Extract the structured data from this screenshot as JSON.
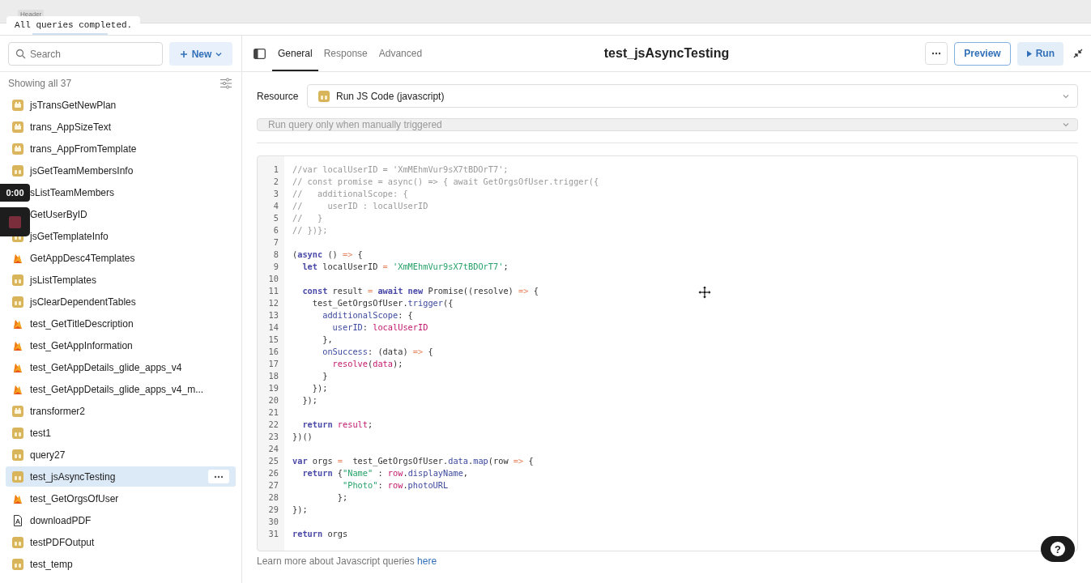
{
  "canvas_header": {
    "tag": "Header",
    "toast": "All queries completed."
  },
  "recorder": {
    "time": "0:00"
  },
  "sidebar": {
    "search": {
      "placeholder": "Search"
    },
    "new_button": "New",
    "count": "Showing all 37",
    "items": [
      {
        "label": "jsTransGetNewPlan",
        "kind": "transformer",
        "selected": false
      },
      {
        "label": "trans_AppSizeText",
        "kind": "transformer",
        "selected": false
      },
      {
        "label": "trans_AppFromTemplate",
        "kind": "transformer",
        "selected": false
      },
      {
        "label": "jsGetTeamMembersInfo",
        "kind": "js",
        "selected": false
      },
      {
        "label": "sListTeamMembers",
        "kind": "covered",
        "selected": false
      },
      {
        "label": "GetUserByID",
        "kind": "covered",
        "selected": false
      },
      {
        "label": "jsGetTemplateInfo",
        "kind": "js",
        "selected": false
      },
      {
        "label": "GetAppDesc4Templates",
        "kind": "firebase",
        "selected": false
      },
      {
        "label": "jsListTemplates",
        "kind": "js",
        "selected": false
      },
      {
        "label": "jsClearDependentTables",
        "kind": "js",
        "selected": false
      },
      {
        "label": "test_GetTitleDescription",
        "kind": "firebase",
        "selected": false
      },
      {
        "label": "test_GetAppInformation",
        "kind": "firebase",
        "selected": false
      },
      {
        "label": "test_GetAppDetails_glide_apps_v4",
        "kind": "firebase",
        "selected": false
      },
      {
        "label": "test_GetAppDetails_glide_apps_v4_m...",
        "kind": "firebase",
        "selected": false
      },
      {
        "label": "transformer2",
        "kind": "transformer",
        "selected": false
      },
      {
        "label": "test1",
        "kind": "js",
        "selected": false
      },
      {
        "label": "query27",
        "kind": "js",
        "selected": false
      },
      {
        "label": "test_jsAsyncTesting",
        "kind": "js",
        "selected": true
      },
      {
        "label": "test_GetOrgsOfUser",
        "kind": "firebase",
        "selected": false
      },
      {
        "label": "downloadPDF",
        "kind": "pdf",
        "selected": false
      },
      {
        "label": "testPDFOutput",
        "kind": "js",
        "selected": false
      },
      {
        "label": "test_temp",
        "kind": "js",
        "selected": false
      }
    ]
  },
  "editor": {
    "tabs": [
      {
        "label": "General",
        "selected": true
      },
      {
        "label": "Response",
        "selected": false
      },
      {
        "label": "Advanced",
        "selected": false
      }
    ],
    "title": "test_jsAsyncTesting",
    "preview_button": "Preview",
    "run_button": "Run",
    "resource_label": "Resource",
    "resource_value": "Run JS Code (javascript)",
    "trigger_value": "Run query only when manually triggered",
    "code": [
      {
        "num": "1",
        "tokens": [
          {
            "kind": "comment",
            "text": "//var localUserID = 'XmMEhmVur9sX7tBDOrT7';"
          }
        ]
      },
      {
        "num": "2",
        "tokens": [
          {
            "kind": "comment",
            "text": "// const promise = async() => { await GetOrgsOfUser.trigger({"
          }
        ]
      },
      {
        "num": "3",
        "tokens": [
          {
            "kind": "comment",
            "text": "//   additionalScope: {"
          }
        ]
      },
      {
        "num": "4",
        "tokens": [
          {
            "kind": "comment",
            "text": "//     userID : localUserID"
          }
        ]
      },
      {
        "num": "5",
        "tokens": [
          {
            "kind": "comment",
            "text": "//   }"
          }
        ]
      },
      {
        "num": "6",
        "tokens": [
          {
            "kind": "comment",
            "text": "// })};"
          }
        ]
      },
      {
        "num": "7"
      },
      {
        "num": "8",
        "tokens": [
          {
            "kind": "plain",
            "text": "("
          },
          {
            "kind": "keyword",
            "text": "async"
          },
          {
            "kind": "plain",
            "text": " () "
          },
          {
            "kind": "operator",
            "text": "=>"
          },
          {
            "kind": "plain",
            "text": " {"
          }
        ]
      },
      {
        "num": "9",
        "tokens": [
          {
            "kind": "keyword",
            "text": "  let"
          },
          {
            "kind": "plain",
            "text": " localUserID "
          },
          {
            "kind": "operator",
            "text": "="
          },
          {
            "kind": "string",
            "text": " 'XmMEhmVur9sX7tBDOrT7'"
          },
          {
            "kind": "plain",
            "text": ";"
          }
        ]
      },
      {
        "num": "10"
      },
      {
        "num": "11",
        "tokens": [
          {
            "kind": "keyword",
            "text": "  const"
          },
          {
            "kind": "plain",
            "text": " result "
          },
          {
            "kind": "operator",
            "text": "="
          },
          {
            "kind": "keyword",
            "text": " await"
          },
          {
            "kind": "keyword",
            "text": " new"
          },
          {
            "kind": "plain",
            "text": " Promise((resolve) "
          },
          {
            "kind": "operator",
            "text": "=>"
          },
          {
            "kind": "plain",
            "text": " {"
          }
        ]
      },
      {
        "num": "12",
        "tokens": [
          {
            "kind": "plain",
            "text": "    test_GetOrgsOfUser."
          },
          {
            "kind": "property",
            "text": "trigger"
          },
          {
            "kind": "plain",
            "text": "({"
          }
        ]
      },
      {
        "num": "13",
        "tokens": [
          {
            "kind": "property",
            "text": "      additionalScope"
          },
          {
            "kind": "plain",
            "text": ": {"
          }
        ]
      },
      {
        "num": "14",
        "tokens": [
          {
            "kind": "property",
            "text": "        userID"
          },
          {
            "kind": "plain",
            "text": ": "
          },
          {
            "kind": "variable",
            "text": "localUserID"
          }
        ]
      },
      {
        "num": "15",
        "tokens": [
          {
            "kind": "plain",
            "text": "      },"
          }
        ]
      },
      {
        "num": "16",
        "tokens": [
          {
            "kind": "property",
            "text": "      onSuccess"
          },
          {
            "kind": "plain",
            "text": ": (data) "
          },
          {
            "kind": "operator",
            "text": "=>"
          },
          {
            "kind": "plain",
            "text": " {"
          }
        ]
      },
      {
        "num": "17",
        "tokens": [
          {
            "kind": "variable",
            "text": "        resolve"
          },
          {
            "kind": "plain",
            "text": "("
          },
          {
            "kind": "variable",
            "text": "data"
          },
          {
            "kind": "plain",
            "text": ");"
          }
        ]
      },
      {
        "num": "18",
        "tokens": [
          {
            "kind": "plain",
            "text": "      }"
          }
        ]
      },
      {
        "num": "19",
        "tokens": [
          {
            "kind": "plain",
            "text": "    });"
          }
        ]
      },
      {
        "num": "20",
        "tokens": [
          {
            "kind": "plain",
            "text": "  });"
          }
        ]
      },
      {
        "num": "21"
      },
      {
        "num": "22",
        "tokens": [
          {
            "kind": "keyword",
            "text": "  return"
          },
          {
            "kind": "variable",
            "text": " result"
          },
          {
            "kind": "plain",
            "text": ";"
          }
        ]
      },
      {
        "num": "23",
        "tokens": [
          {
            "kind": "plain",
            "text": "})()"
          }
        ]
      },
      {
        "num": "24"
      },
      {
        "num": "25",
        "tokens": [
          {
            "kind": "keyword",
            "text": "var"
          },
          {
            "kind": "plain",
            "text": " orgs "
          },
          {
            "kind": "operator",
            "text": "="
          },
          {
            "kind": "plain",
            "text": "  test_GetOrgsOfUser."
          },
          {
            "kind": "property",
            "text": "data"
          },
          {
            "kind": "plain",
            "text": "."
          },
          {
            "kind": "property",
            "text": "map"
          },
          {
            "kind": "plain",
            "text": "(row "
          },
          {
            "kind": "operator",
            "text": "=>"
          },
          {
            "kind": "plain",
            "text": " {"
          }
        ]
      },
      {
        "num": "26",
        "tokens": [
          {
            "kind": "keyword",
            "text": "  return"
          },
          {
            "kind": "plain",
            "text": " {"
          },
          {
            "kind": "string",
            "text": "\"Name\""
          },
          {
            "kind": "plain",
            "text": " : "
          },
          {
            "kind": "variable",
            "text": "row"
          },
          {
            "kind": "plain",
            "text": "."
          },
          {
            "kind": "property",
            "text": "displayName"
          },
          {
            "kind": "plain",
            "text": ","
          }
        ]
      },
      {
        "num": "27",
        "tokens": [
          {
            "kind": "string",
            "text": "          \"Photo\""
          },
          {
            "kind": "plain",
            "text": ": "
          },
          {
            "kind": "variable",
            "text": "row"
          },
          {
            "kind": "plain",
            "text": "."
          },
          {
            "kind": "property",
            "text": "photoURL"
          }
        ]
      },
      {
        "num": "28",
        "tokens": [
          {
            "kind": "plain",
            "text": "         };"
          }
        ]
      },
      {
        "num": "29",
        "tokens": [
          {
            "kind": "plain",
            "text": "});"
          }
        ]
      },
      {
        "num": "30"
      },
      {
        "num": "31",
        "tokens": [
          {
            "kind": "keyword",
            "text": "return"
          },
          {
            "kind": "plain",
            "text": " orgs"
          }
        ]
      }
    ],
    "footer": "Learn more about Javascript queries ",
    "footer_link": "here"
  },
  "help_button": "?"
}
